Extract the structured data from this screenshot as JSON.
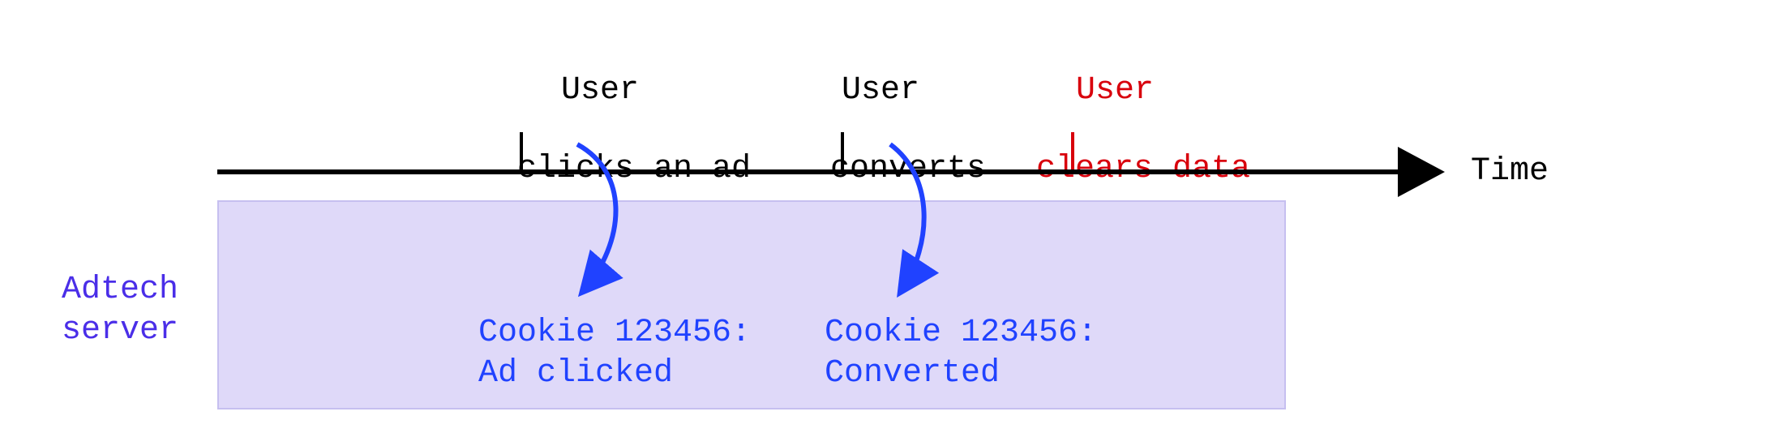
{
  "axis_label": "Time",
  "events": {
    "click": {
      "line1": "User",
      "line2": "clicks an ad"
    },
    "convert": {
      "line1": "User",
      "line2": "converts"
    },
    "clear": {
      "line1": "User",
      "line2": "clears data"
    }
  },
  "server_label": "Adtech\nserver",
  "records": {
    "r1": "Cookie 123456:\nAd clicked",
    "r2": "Cookie 123456:\nConverted"
  }
}
